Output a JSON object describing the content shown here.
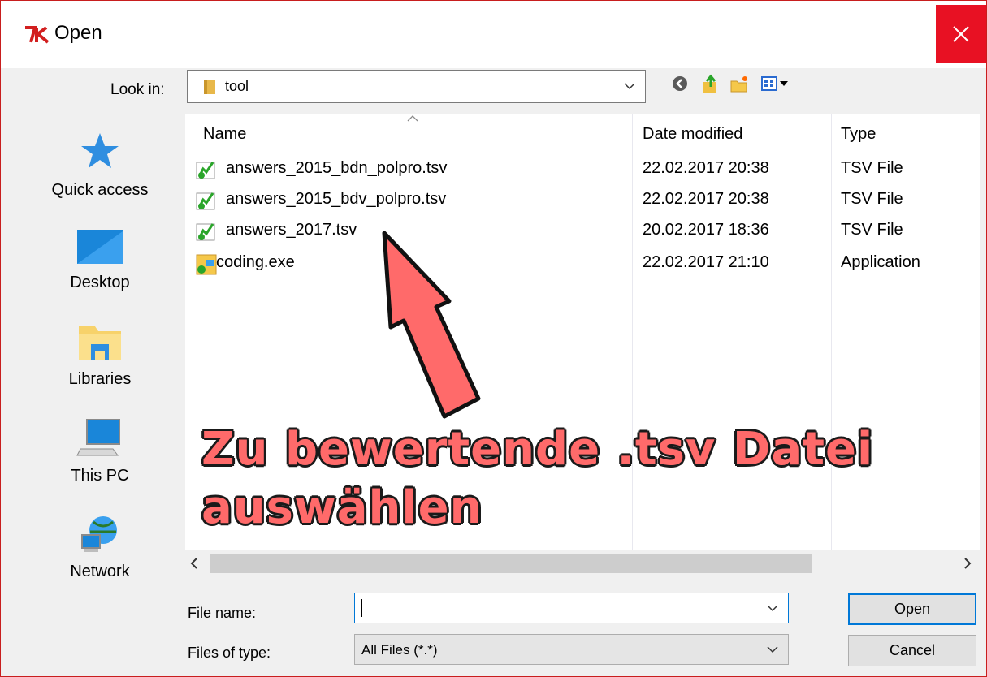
{
  "window": {
    "title": "Open",
    "app_icon": "tk-feather-icon",
    "close_icon": "close-icon"
  },
  "look_in": {
    "label": "Look in:",
    "value": "tool"
  },
  "toolbar": {
    "icons": [
      "back-icon",
      "up-folder-icon",
      "new-folder-icon",
      "view-menu-icon"
    ]
  },
  "places": [
    {
      "label": "Quick access",
      "icon": "quick-access-star-icon"
    },
    {
      "label": "Desktop",
      "icon": "desktop-icon"
    },
    {
      "label": "Libraries",
      "icon": "libraries-icon"
    },
    {
      "label": "This PC",
      "icon": "this-pc-icon"
    },
    {
      "label": "Network",
      "icon": "network-icon"
    }
  ],
  "columns": {
    "name": "Name",
    "date": "Date modified",
    "type": "Type"
  },
  "files": [
    {
      "name": "answers_2015_bdn_polpro.tsv",
      "date": "22.02.2017 20:38",
      "type": "TSV File",
      "icon": "tsv-file-icon"
    },
    {
      "name": "answers_2015_bdv_polpro.tsv",
      "date": "22.02.2017 20:38",
      "type": "TSV File",
      "icon": "tsv-file-icon"
    },
    {
      "name": "answers_2017.tsv",
      "date": "20.02.2017 18:36",
      "type": "TSV File",
      "icon": "tsv-file-icon"
    },
    {
      "name": "coding.exe",
      "date": "22.02.2017 21:10",
      "type": "Application",
      "icon": "exe-file-icon"
    }
  ],
  "file_name": {
    "label": "File name:",
    "value": ""
  },
  "file_type": {
    "label": "Files of type:",
    "value": "All Files (*.*)"
  },
  "buttons": {
    "open": "Open",
    "cancel": "Cancel"
  },
  "annotation": {
    "line1": "Zu bewertende .tsv Datei",
    "line2": "auswählen"
  },
  "colors": {
    "close_red": "#e81123",
    "annotation_fill": "#ff6a6a",
    "focus_blue": "#0078d7"
  }
}
